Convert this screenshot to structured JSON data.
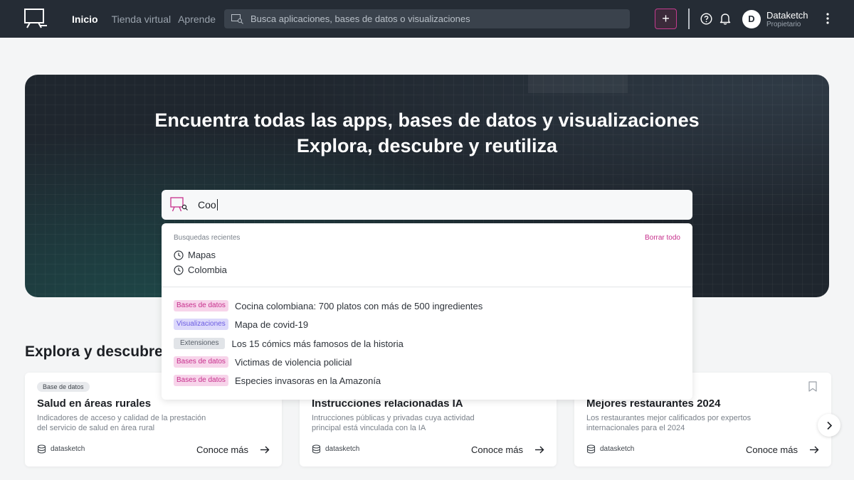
{
  "nav": {
    "items": [
      {
        "label": "Inicio",
        "active": true
      },
      {
        "label": "Tienda virtual",
        "active": false
      },
      {
        "label": "Aprende",
        "active": false
      }
    ],
    "search_placeholder": "Busca aplicaciones, bases de datos o visualizaciones",
    "add_label": "+",
    "user": {
      "initial": "D",
      "name": "Dataketch",
      "role": "Propietario"
    }
  },
  "hero": {
    "title": "Encuentra todas las apps, bases de datos y visualizaciones",
    "subtitle": "Explora, descubre y reutiliza"
  },
  "search": {
    "query": "Coo",
    "recent_title": "Busquedas recientes",
    "clear_label": "Borrar todo",
    "recent": [
      "Mapas",
      "Colombia"
    ],
    "results": [
      {
        "tag": "Bases de datos",
        "kind": "db",
        "text": "Cocina colombiana: 700 platos con más de 500 ingredientes"
      },
      {
        "tag": "Visualizaciones",
        "kind": "viz",
        "text": "Mapa de covid-19"
      },
      {
        "tag": "Extensiones",
        "kind": "ext",
        "text": "Los 15 cómics más famosos de la historia"
      },
      {
        "tag": "Bases de datos",
        "kind": "db",
        "text": "Victimas de violencia policial"
      },
      {
        "tag": "Bases de datos",
        "kind": "db",
        "text": "Especies invasoras en la Amazonía"
      }
    ]
  },
  "explore": {
    "title": "Explora y descubre",
    "cards": [
      {
        "badge": "Base de datos",
        "title": "Salud en áreas rurales",
        "desc": "Indicadores de acceso y calidad de la prestación del servicio de salud en área rural",
        "source": "datasketch",
        "more": "Conoce más"
      },
      {
        "badge": "",
        "title": "Instrucciones relacionadas IA",
        "desc": "Intrucciones públicas y privadas cuya actividad principal está vinculada con la IA",
        "source": "datasketch",
        "more": "Conoce más"
      },
      {
        "badge": "",
        "title": "Mejores restaurantes 2024",
        "desc": "Los restaurantes mejor calificados por expertos internacionales para el 2024",
        "source": "datasketch",
        "more": "Conoce más"
      }
    ]
  },
  "colors": {
    "topbar": "#252c35",
    "accent": "#c72f8c",
    "hero_bg": "#1f262e",
    "tag_db_bg": "#f7d4ea",
    "tag_viz_bg": "#dcd8fb",
    "tag_ext_bg": "#e1e4e8"
  }
}
